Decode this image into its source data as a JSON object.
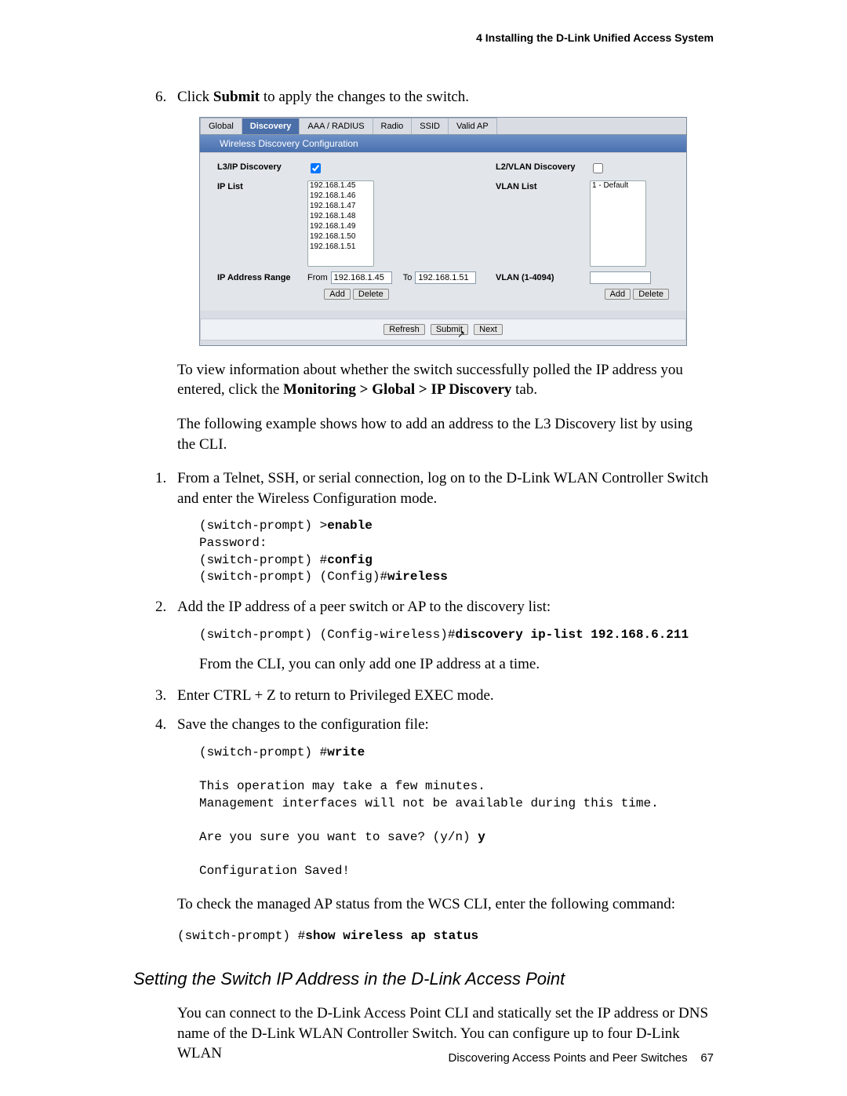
{
  "header": "4   Installing the D-Link Unified Access System",
  "step6": {
    "num": "6.",
    "text_a": "Click ",
    "b": "Submit",
    "text_b": " to apply the changes to the switch."
  },
  "shot": {
    "tabs": [
      "Global",
      "Discovery",
      "AAA / RADIUS",
      "Radio",
      "SSID",
      "Valid AP"
    ],
    "active_tab": 1,
    "panel_title": "Wireless Discovery Configuration",
    "l3_label": "L3/IP Discovery",
    "ip_list_label": "IP List",
    "ip_list": [
      "192.168.1.45",
      "192.168.1.46",
      "192.168.1.47",
      "192.168.1.48",
      "192.168.1.49",
      "192.168.1.50",
      "192.168.1.51"
    ],
    "range_label": "IP Address Range",
    "from": "From",
    "to": "To",
    "from_val": "192.168.1.45",
    "to_val": "192.168.1.51",
    "l2_label": "L2/VLAN Discovery",
    "vlan_list_label": "VLAN List",
    "vlan_list": [
      "1 - Default"
    ],
    "vlan_range_label": "VLAN (1-4094)",
    "btn_add": "Add",
    "btn_delete": "Delete",
    "btn_refresh": "Refresh",
    "btn_submit": "Submit",
    "btn_next": "Next"
  },
  "para_view_a": "To view information about whether the switch successfully polled the IP address you entered, click the ",
  "para_view_b": "Monitoring > Global > IP Discovery",
  "para_view_c": " tab.",
  "para_ex": "The following example shows how to add an address to the L3 Discovery list by using the CLI.",
  "step1": {
    "num": "1.",
    "text": "From a Telnet, SSH, or serial connection, log on to the D-Link WLAN Controller Switch and enter the Wireless Configuration mode."
  },
  "code1": {
    "l1": "(switch-prompt) >",
    "b1": "enable",
    "l2": "Password:",
    "l3": "(switch-prompt) #",
    "b3": "config",
    "l4": "(switch-prompt) (Config)#",
    "b4": "wireless"
  },
  "step2": {
    "num": "2.",
    "text": "Add the IP address of a peer switch or AP to the discovery list:"
  },
  "code2": {
    "l": "(switch-prompt) (Config-wireless)#",
    "b": "discovery ip-list 192.168.6.211"
  },
  "sub2": "From the CLI, you can only add one IP address at a time.",
  "step3": {
    "num": "3.",
    "text": "Enter CTRL + Z to return to Privileged EXEC mode."
  },
  "step4": {
    "num": "4.",
    "text": "Save the changes to the configuration file:"
  },
  "code4": {
    "l1": "(switch-prompt) #",
    "b1": "write",
    "blank1": "",
    "l2": "This operation may take a few minutes.",
    "l3": "Management interfaces will not be available during this time.",
    "blank2": "",
    "l4": "Are you sure you want to save? (y/n) ",
    "b4": "y",
    "blank3": "",
    "l5": "Configuration Saved!"
  },
  "para_check": "To check the managed AP status from the WCS CLI, enter the following command:",
  "code5": {
    "l": "(switch-prompt) #",
    "b": "show wireless ap status"
  },
  "h2": "Setting the Switch IP Address in the D-Link Access Point",
  "para_last": "You can connect to the D-Link Access Point CLI and statically set the IP address or DNS name of the D-Link WLAN Controller Switch. You can configure up to four D-Link WLAN",
  "footer": {
    "text": "Discovering Access Points and Peer Switches",
    "page": "67"
  }
}
